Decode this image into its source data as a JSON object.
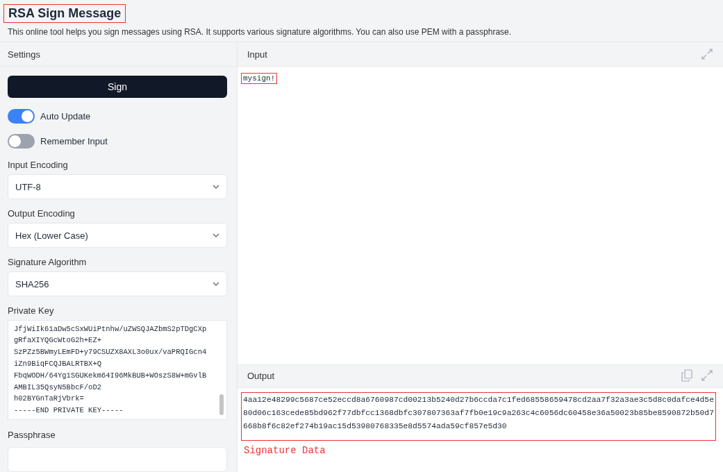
{
  "header": {
    "title": "RSA Sign Message",
    "description": "This online tool helps you sign messages using RSA. It supports various signature algorithms. You can also use PEM with a passphrase."
  },
  "settings": {
    "title": "Settings",
    "sign_button": "Sign",
    "toggles": [
      {
        "label": "Auto Update",
        "on": true
      },
      {
        "label": "Remember Input",
        "on": false
      }
    ],
    "selects": [
      {
        "label": "Input Encoding",
        "value": "UTF-8"
      },
      {
        "label": "Output Encoding",
        "value": "Hex (Lower Case)"
      },
      {
        "label": "Signature Algorithm",
        "value": "SHA256"
      }
    ],
    "private_key": {
      "label": "Private Key",
      "lines": [
        "JfjWiIk61aDw5cSxWUiPtnhw/uZWSQJAZbmS2pTDgCXp",
        "gRfaXIYQGcWtoG2h+EZ+",
        "SzPZz5BWmyLEmFD+y79CSUZX8AXL3o0ux/vaPRQIGcn4",
        "iZn9BiqFCQJBALRTBX+Q",
        "FbqWODH/64Yg1SGUKekm64I96MkBUB+WOszS8W+mGvlB",
        "AMBIL35QsyN5BbcF/oD2",
        "h02BYGnTaRjVbrk=",
        "-----END PRIVATE KEY-----"
      ]
    },
    "passphrase": {
      "label": "Passphrase"
    }
  },
  "input": {
    "title": "Input",
    "value": "mysign!"
  },
  "output": {
    "title": "Output",
    "value": "4aa12e48299c5687ce52eccd8a6760987cd00213b5240d27b6ccda7c1fed68558659478cd2aa7f32a3ae3c5d8c0dafce4d5e80d06c163cede85bd962f77dbfcc1368dbfc307807363af7fb0e19c9a263c4c6056dc60458e36a50023b85be8590872b50d7668b8f6c82ef274b19ac15d53980768335e8d5574ada59cf857e5d30",
    "annotation": "Signature Data"
  }
}
